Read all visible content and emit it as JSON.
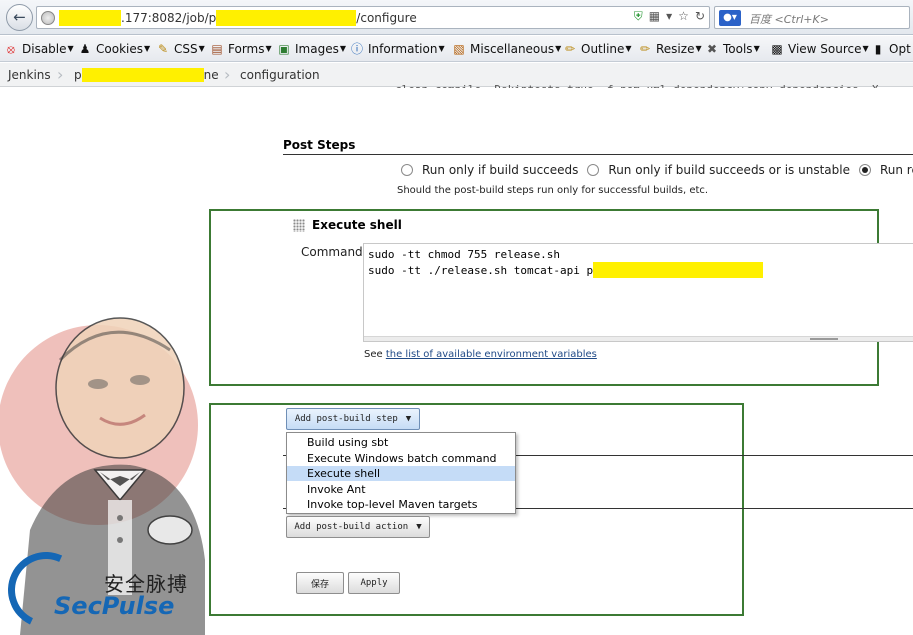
{
  "browser": {
    "url": {
      "after_host_redacted": ".177:8082/job/p",
      "suffix": "/configure"
    },
    "search_placeholder": "百度 <Ctrl+K>",
    "search_engine_icon": "baidu-paw-icon"
  },
  "webdev_toolbar": {
    "items": [
      {
        "label": "Disable",
        "icon": "disable-icon"
      },
      {
        "label": "Cookies",
        "icon": "cookies-icon"
      },
      {
        "label": "CSS",
        "icon": "css-icon"
      },
      {
        "label": "Forms",
        "icon": "forms-icon"
      },
      {
        "label": "Images",
        "icon": "images-icon"
      },
      {
        "label": "Information",
        "icon": "information-icon"
      },
      {
        "label": "Miscellaneous",
        "icon": "miscellaneous-icon"
      },
      {
        "label": "Outline",
        "icon": "outline-icon"
      },
      {
        "label": "Resize",
        "icon": "resize-icon"
      },
      {
        "label": "Tools",
        "icon": "tools-icon"
      },
      {
        "label": "View Source",
        "icon": "view-source-icon"
      },
      {
        "label": "Opt",
        "icon": "options-icon"
      }
    ]
  },
  "breadcrumb": {
    "root": "Jenkins",
    "job_prefix": "p",
    "job_suffix": "ne",
    "current": "configuration"
  },
  "post_steps": {
    "title": "Post Steps",
    "options": [
      {
        "label": "Run only if build succeeds",
        "checked": false
      },
      {
        "label": "Run only if build succeeds or is unstable",
        "checked": false
      },
      {
        "label": "Run rega",
        "checked": true
      }
    ],
    "help": "Should the post-build steps run only for successful builds, etc."
  },
  "execute_shell": {
    "title": "Execute shell",
    "command_label": "Command",
    "lines": [
      "sudo -tt chmod 755 release.sh",
      "sudo -tt ./release.sh tomcat-api p"
    ],
    "see_prefix": "See ",
    "env_link": "the list of available environment variables"
  },
  "add_post_build_step": {
    "label": "Add post-build step",
    "menu_items": [
      "Build using sbt",
      "Execute Windows batch command",
      "Execute shell",
      "Invoke Ant",
      "Invoke top-level Maven targets"
    ],
    "selected_index": 2
  },
  "add_post_build_action_label": "Add post-build action",
  "save_label": "保存",
  "apply_label": "Apply",
  "watermark": {
    "cn": "安全脉搏",
    "en": "SecPulse"
  },
  "colors": {
    "annotation_green": "#3c7a34",
    "redaction_yellow": "#fff000",
    "menu_highlight": "#c5dcf7",
    "watermark_blue": "#1567b5"
  }
}
